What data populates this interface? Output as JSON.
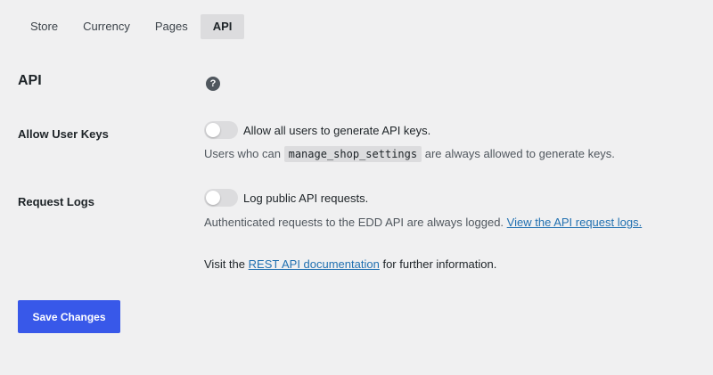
{
  "tabs": [
    {
      "label": "Store",
      "active": false
    },
    {
      "label": "Currency",
      "active": false
    },
    {
      "label": "Pages",
      "active": false
    },
    {
      "label": "API",
      "active": true
    }
  ],
  "section": {
    "title": "API",
    "help_icon": "question-mark",
    "help_glyph": "?"
  },
  "fields": {
    "allow_user_keys": {
      "label": "Allow User Keys",
      "toggle_on": false,
      "toggle_label": "Allow all users to generate API keys.",
      "desc_before": "Users who can",
      "desc_code": "manage_shop_settings",
      "desc_after": "are always allowed to generate keys."
    },
    "request_logs": {
      "label": "Request Logs",
      "toggle_on": false,
      "toggle_label": "Log public API requests.",
      "desc_before": "Authenticated requests to the EDD API are always logged.",
      "desc_link": "View the API request logs."
    }
  },
  "footer_note": {
    "before": "Visit the",
    "link": "REST API documentation",
    "after": "for further information."
  },
  "save_button": {
    "label": "Save Changes"
  },
  "colors": {
    "background": "#f0f0f1",
    "primary_button": "#3858e9",
    "link": "#2271b1",
    "toggle_off": "#dcdcde"
  }
}
